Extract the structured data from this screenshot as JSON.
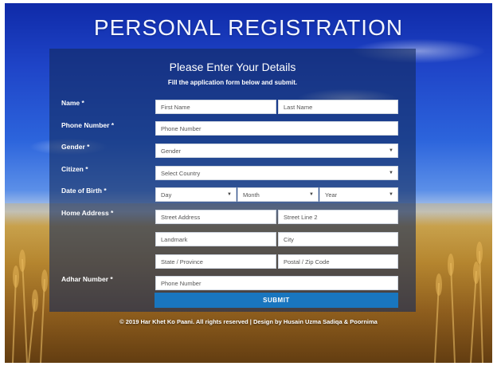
{
  "page": {
    "title": "PERSONAL REGISTRATION"
  },
  "form": {
    "heading": "Please Enter Your Details",
    "subheading": "Fill the application form below and submit.",
    "labels": {
      "name": "Name *",
      "phone": "Phone Number *",
      "gender": "Gender *",
      "citizen": "Citizen *",
      "dob": "Date of Birth *",
      "address": "Home Address *",
      "adhar": "Adhar Number *"
    },
    "placeholders": {
      "first_name": "First Name",
      "last_name": "Last Name",
      "phone": "Phone Number",
      "gender": "Gender",
      "country": "Select Country",
      "day": "Day",
      "month": "Month",
      "year": "Year",
      "street1": "Street Address",
      "street2": "Street Line 2",
      "landmark": "Landmark",
      "city": "City",
      "state": "State / Province",
      "zip": "Postal / Zip Code",
      "adhar": "Phone Number"
    },
    "submit_label": "SUBMIT"
  },
  "footer": {
    "text": "© 2019 Har Khet Ko Paani. All rights reserved | Design by Husain Uzma Sadiqa & Poornima"
  }
}
